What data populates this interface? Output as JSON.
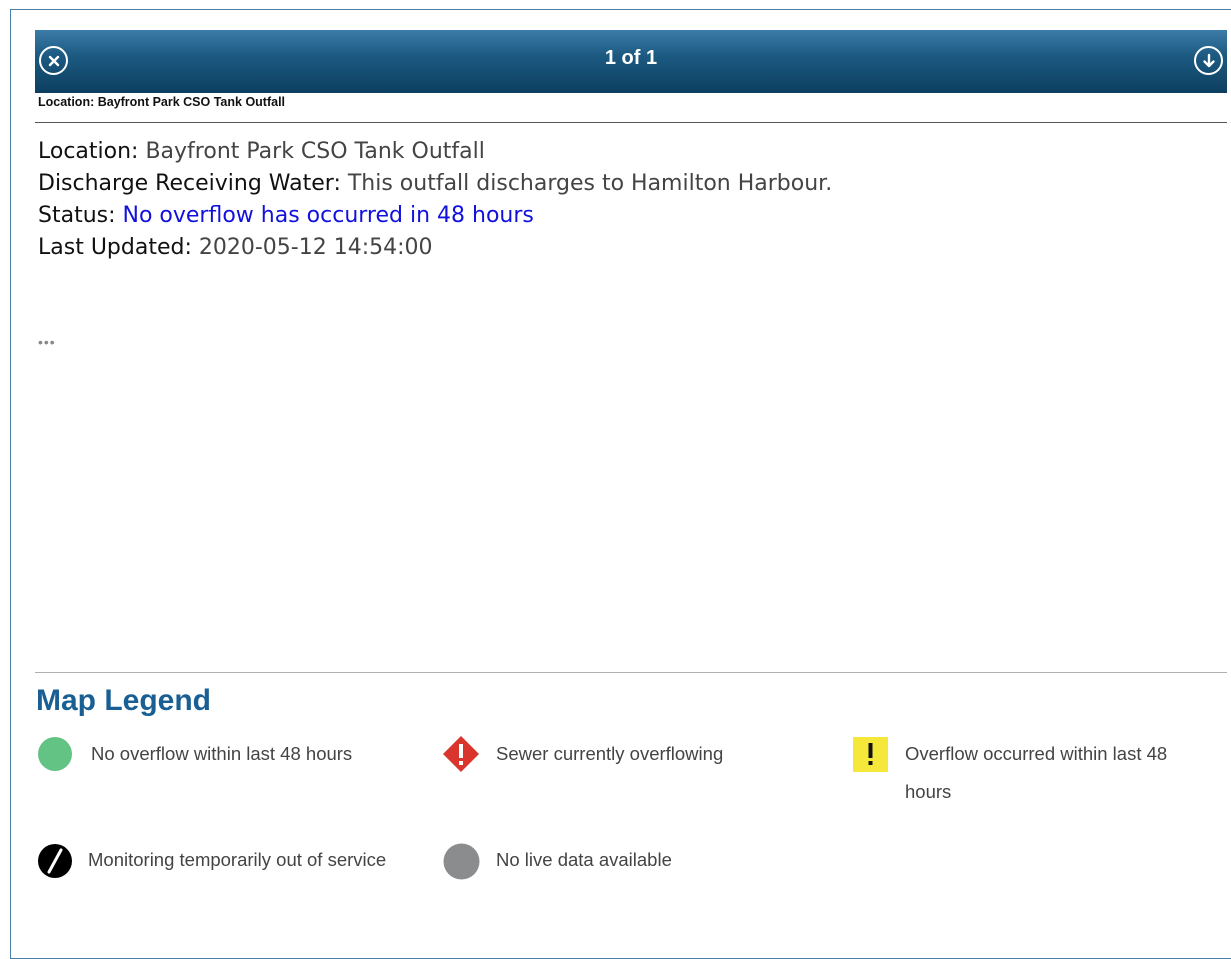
{
  "popup": {
    "counter": "1 of 1",
    "subtitle": "Location: Bayfront Park CSO Tank Outfall"
  },
  "details": {
    "location_label": "Location:",
    "location_value": " Bayfront Park CSO Tank Outfall",
    "discharge_label": "Discharge Receiving Water:",
    "discharge_value": " This outfall discharges to Hamilton Harbour.",
    "status_label": "Status:",
    "status_value": " No overflow has occurred in 48 hours",
    "updated_label": "Last Updated:",
    "updated_value": " 2020-05-12 14:54:00"
  },
  "more_indicator": "•••",
  "legend": {
    "title": "Map Legend",
    "items": [
      {
        "label": "No overflow within last 48 hours",
        "icon": "green-circle-icon",
        "color": "#62c384"
      },
      {
        "label": "Sewer currently overflowing",
        "icon": "red-diamond-alert-icon",
        "color": "#d9352c"
      },
      {
        "label": "Overflow occurred within last 48 hours",
        "icon": "yellow-exclamation-icon",
        "color": "#f5e83a"
      },
      {
        "label": "Monitoring temporarily out of service",
        "icon": "black-slash-circle-icon",
        "color": "#000000"
      },
      {
        "label": "No live data available",
        "icon": "gray-circle-icon",
        "color": "#8a8c8e"
      }
    ]
  }
}
